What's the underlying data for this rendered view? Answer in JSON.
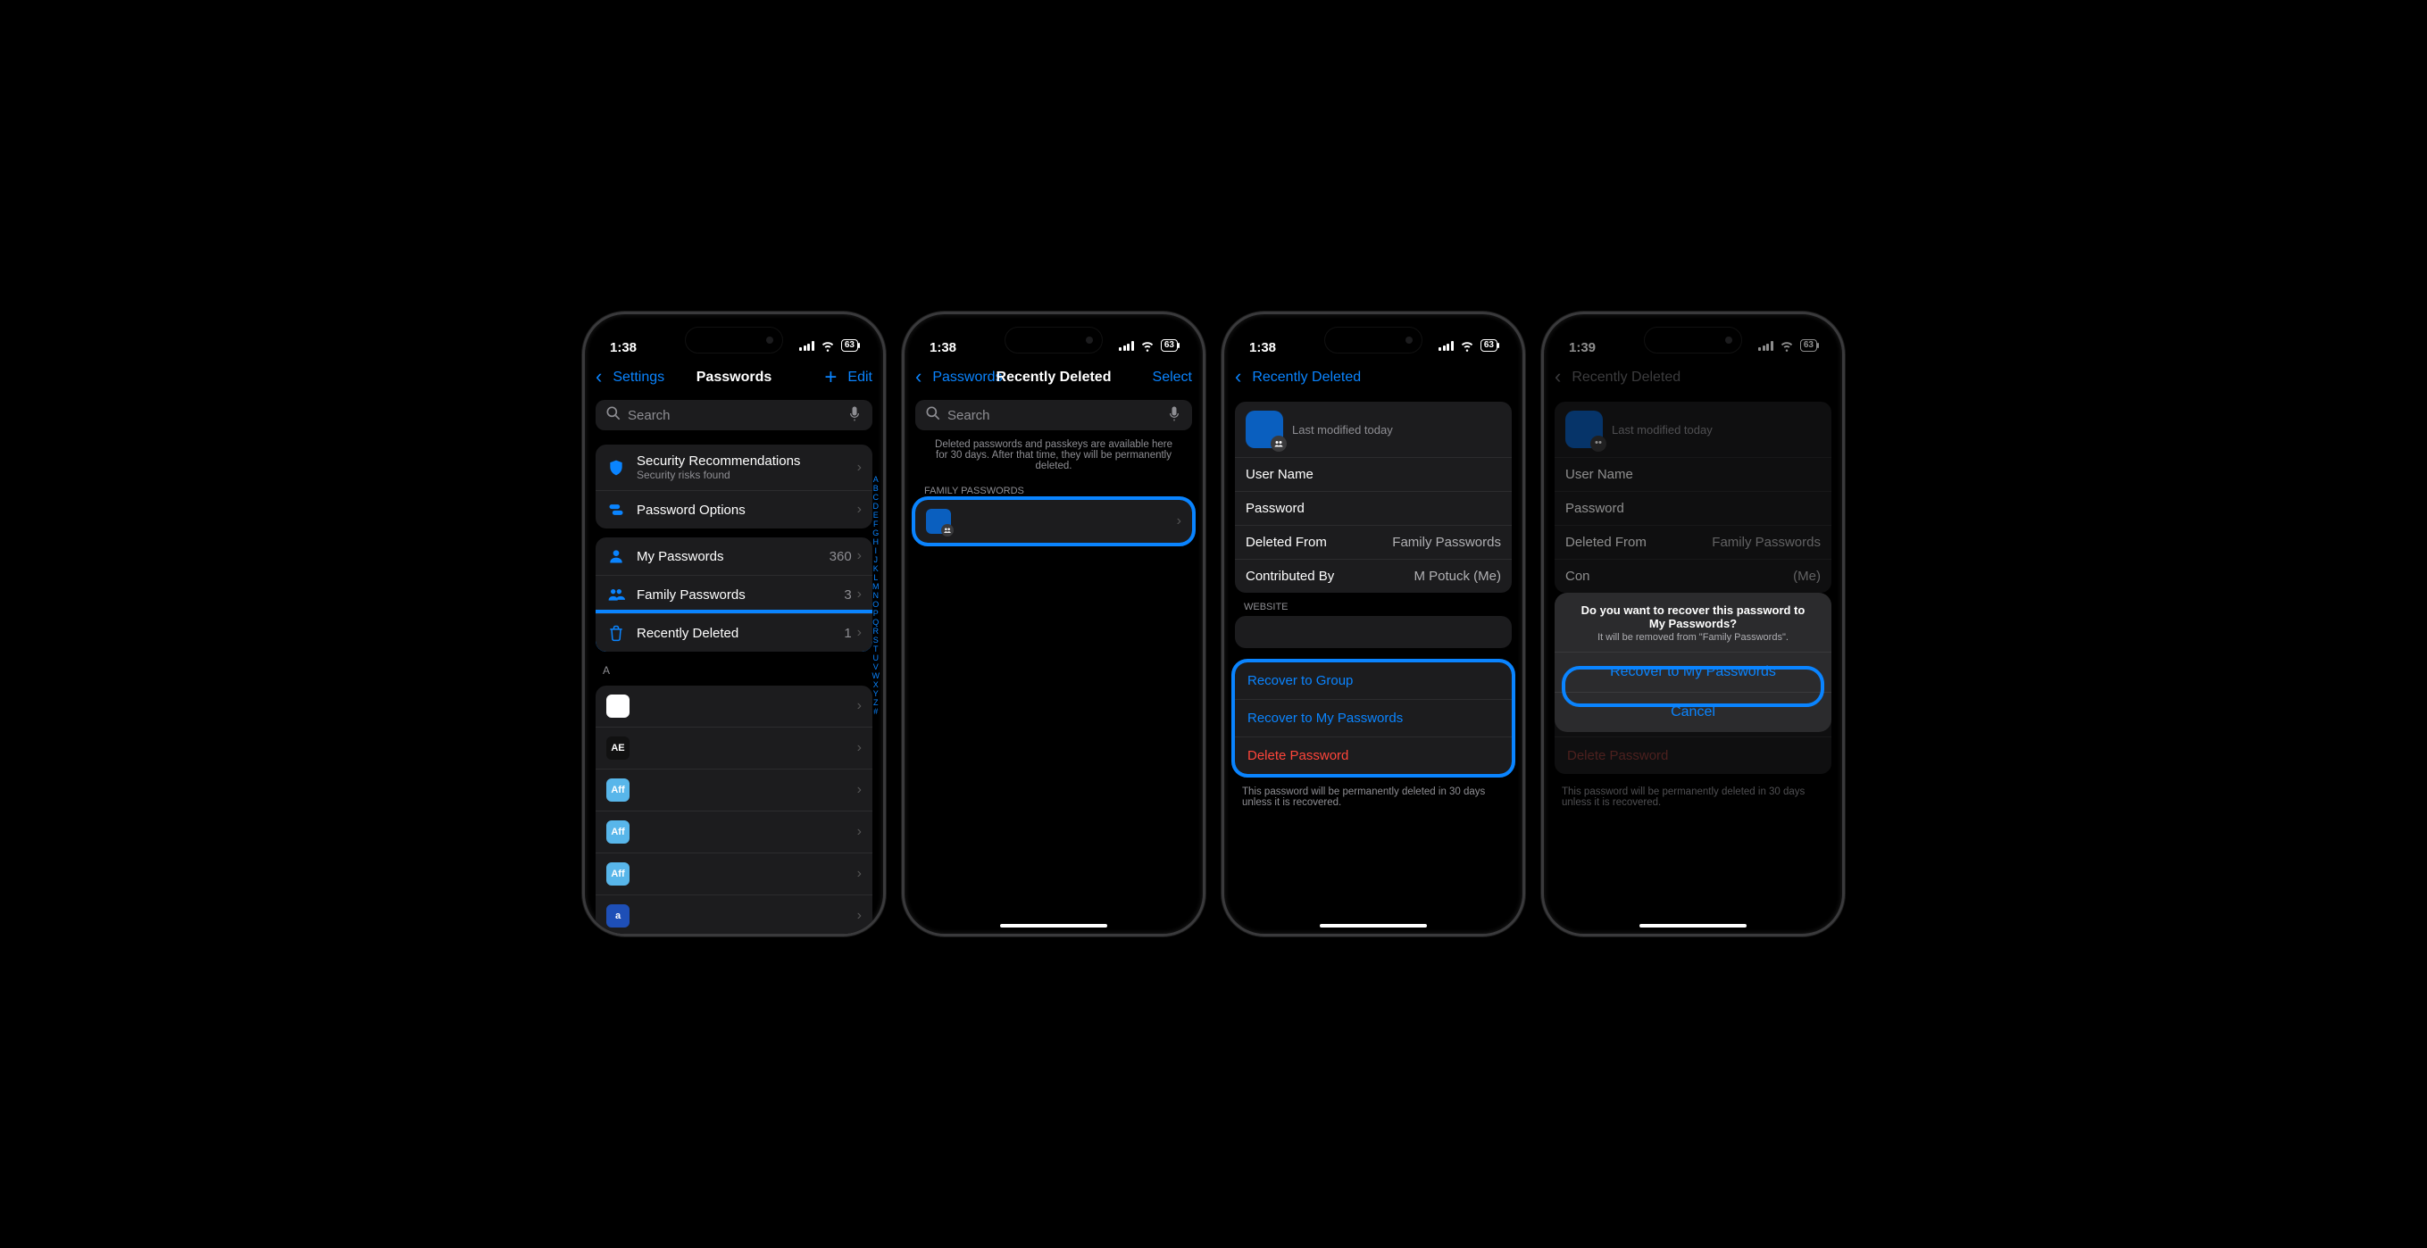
{
  "status": {
    "time1": "1:38",
    "time4": "1:39",
    "battery": "63"
  },
  "s1": {
    "back": "Settings",
    "title": "Passwords",
    "edit": "Edit",
    "search": "Search",
    "secRec": "Security Recommendations",
    "secSub": "Security risks found",
    "pwOpt": "Password Options",
    "myPw": "My Passwords",
    "myPwCount": "360",
    "famPw": "Family Passwords",
    "famPwCount": "3",
    "recDel": "Recently Deleted",
    "recDelCount": "1",
    "indexA": "A",
    "index": [
      "A",
      "B",
      "C",
      "D",
      "E",
      "F",
      "G",
      "H",
      "I",
      "J",
      "K",
      "L",
      "M",
      "N",
      "O",
      "P",
      "Q",
      "R",
      "S",
      "T",
      "U",
      "V",
      "W",
      "X",
      "Y",
      "Z",
      "#"
    ],
    "apps": [
      {
        "bg": "#fff",
        "fg": "#c0392b",
        "t": ""
      },
      {
        "bg": "#111",
        "fg": "#fff",
        "t": "AE"
      },
      {
        "bg": "#58b6ea",
        "fg": "#fff",
        "t": "Aff"
      },
      {
        "bg": "#58b6ea",
        "fg": "#fff",
        "t": "Aff"
      },
      {
        "bg": "#58b6ea",
        "fg": "#fff",
        "t": "Aff"
      },
      {
        "bg": "#1e4fb7",
        "fg": "#fff",
        "t": "a"
      }
    ]
  },
  "s2": {
    "back": "Passwords",
    "title": "Recently Deleted",
    "select": "Select",
    "search": "Search",
    "note": "Deleted passwords and passkeys are available here for 30 days. After that time, they will be permanently deleted.",
    "groupHeader": "FAMILY PASSWORDS"
  },
  "s3": {
    "back": "Recently Deleted",
    "modified": "Last modified today",
    "userName": "User Name",
    "password": "Password",
    "deletedFrom": "Deleted From",
    "deletedFromVal": "Family Passwords",
    "contributed": "Contributed By",
    "contributedVal": "M Potuck (Me)",
    "websiteHdr": "WEBSITE",
    "recGroup": "Recover to Group",
    "recMine": "Recover to My Passwords",
    "delPw": "Delete Password",
    "footnote": "This password will be permanently deleted in 30 days unless it is recovered."
  },
  "s4": {
    "sheetTitle": "Do you want to recover this password to My Passwords?",
    "sheetSub": "It will be removed from \"Family Passwords\".",
    "sheetRecover": "Recover to My Passwords",
    "sheetCancel": "Cancel"
  }
}
